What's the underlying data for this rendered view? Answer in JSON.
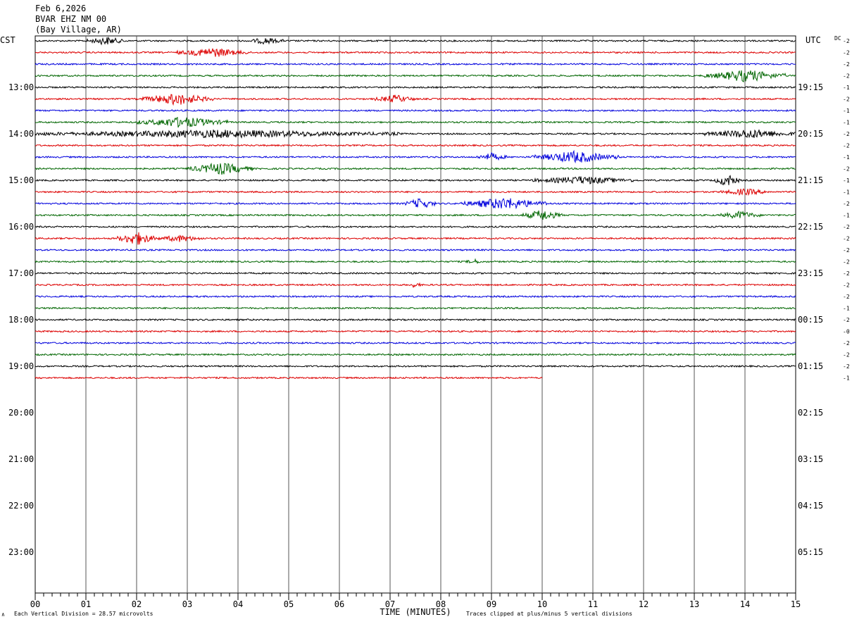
{
  "header": {
    "date": "Feb 6,2026",
    "station": "BVAR EHZ NM 00",
    "location": "(Bay Village, AR)"
  },
  "left_axis_title": "CST",
  "right_axis_title": "UTC",
  "dc_label": "DC",
  "footer": {
    "division": "Each Vertical Division =   28.57 microvolts",
    "clipped": "Traces clipped at plus/minus 5 vertical divisions",
    "corner_mark": "∧"
  },
  "colors": {
    "trace_cycle": [
      "#000000",
      "#dd0000",
      "#0000dd",
      "#006600"
    ],
    "grid": "#555555"
  },
  "chart_data": {
    "type": "line",
    "title": "BVAR EHZ NM 00",
    "xlabel": "TIME (MINUTES)",
    "ylabel": "",
    "x_ticks": [
      "00",
      "01",
      "02",
      "03",
      "04",
      "05",
      "06",
      "07",
      "08",
      "09",
      "10",
      "11",
      "12",
      "13",
      "14",
      "15"
    ],
    "xlim": [
      0,
      15
    ],
    "left_hour_labels": [
      "13:00",
      "14:00",
      "15:00",
      "16:00",
      "17:00",
      "18:00",
      "19:00",
      "20:00",
      "21:00",
      "22:00",
      "23:00"
    ],
    "right_hour_labels": [
      "19:15",
      "20:15",
      "21:15",
      "22:15",
      "23:15",
      "00:15",
      "01:15",
      "02:15",
      "03:15",
      "04:15",
      "05:15"
    ],
    "trace_count": 30,
    "last_trace_end_minute": 10,
    "dc_offsets": [
      "-2",
      "-2",
      "-2",
      "-2",
      "-1",
      "-2",
      "-1",
      "-1",
      "-2",
      "-2",
      "-1",
      "-2",
      "-1",
      "-1",
      "-2",
      "-1",
      "-2",
      "-2",
      "-2",
      "-2",
      "-2",
      "-2",
      "-2",
      "-1",
      "-2",
      "-0",
      "-2",
      "-2",
      "-2",
      "-1"
    ],
    "events": [
      {
        "trace": 0,
        "start": 1.0,
        "end": 1.8,
        "amplitude": 5
      },
      {
        "trace": 0,
        "start": 4.2,
        "end": 4.9,
        "amplitude": 4
      },
      {
        "trace": 1,
        "start": 2.8,
        "end": 4.2,
        "amplitude": 6
      },
      {
        "trace": 3,
        "start": 13.2,
        "end": 14.8,
        "amplitude": 8
      },
      {
        "trace": 5,
        "start": 2.1,
        "end": 3.5,
        "amplitude": 8
      },
      {
        "trace": 5,
        "start": 6.7,
        "end": 7.5,
        "amplitude": 5
      },
      {
        "trace": 7,
        "start": 2.0,
        "end": 3.8,
        "amplitude": 7
      },
      {
        "trace": 8,
        "start": 0.0,
        "end": 7.2,
        "amplitude": 5
      },
      {
        "trace": 8,
        "start": 13.2,
        "end": 15.0,
        "amplitude": 6
      },
      {
        "trace": 10,
        "start": 8.7,
        "end": 9.3,
        "amplitude": 5
      },
      {
        "trace": 10,
        "start": 9.8,
        "end": 11.5,
        "amplitude": 8
      },
      {
        "trace": 11,
        "start": 3.0,
        "end": 4.3,
        "amplitude": 8
      },
      {
        "trace": 12,
        "start": 9.8,
        "end": 11.8,
        "amplitude": 5
      },
      {
        "trace": 12,
        "start": 13.4,
        "end": 13.9,
        "amplitude": 8
      },
      {
        "trace": 13,
        "start": 13.5,
        "end": 14.5,
        "amplitude": 4
      },
      {
        "trace": 14,
        "start": 7.3,
        "end": 7.9,
        "amplitude": 7
      },
      {
        "trace": 14,
        "start": 8.4,
        "end": 10.1,
        "amplitude": 8
      },
      {
        "trace": 15,
        "start": 9.6,
        "end": 10.4,
        "amplitude": 7
      },
      {
        "trace": 15,
        "start": 13.5,
        "end": 14.3,
        "amplitude": 5
      },
      {
        "trace": 17,
        "start": 1.6,
        "end": 2.4,
        "amplitude": 9
      },
      {
        "trace": 17,
        "start": 2.4,
        "end": 3.3,
        "amplitude": 4
      },
      {
        "trace": 19,
        "start": 8.5,
        "end": 8.8,
        "amplitude": 3
      },
      {
        "trace": 21,
        "start": 7.4,
        "end": 7.6,
        "amplitude": 4
      }
    ]
  }
}
